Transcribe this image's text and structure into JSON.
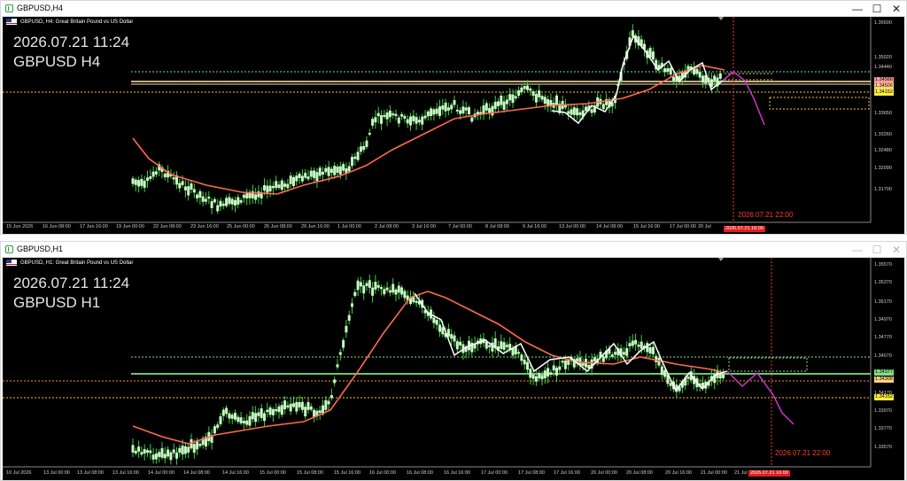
{
  "windows": [
    {
      "title": "GBPUSD,H4",
      "controls": {
        "minimize": "—",
        "maximize": "☐",
        "close": "✕"
      },
      "header": "GBPUSD, H4:  Great Britain Pound vs US Dollar",
      "datetime": "2026.07.21 11:24",
      "symbol_tf": "GBPUSD H4",
      "marker_label": "2026.07.21 22:00",
      "time_box": "2026.07.21 16:00",
      "price_ticks": [
        "1.35600",
        "1.35020",
        "1.34440",
        "1.34230",
        "1.33650",
        "1.33260",
        "1.32480",
        "1.32090",
        "1.31700"
      ],
      "price_boxes": [
        {
          "text": "1.34566",
          "bg": "#ff9aa2"
        },
        {
          "text": "1.34506",
          "bg": "#ffd27f"
        },
        {
          "text": "1.34152",
          "bg": "#ffef3b"
        }
      ],
      "time_ticks": [
        "15 Jun 2026",
        "16 Jun 08:00",
        "17 Jun 16:00",
        "19 Jun 00:00",
        "22 Jun 08:00",
        "23 Jun 16:00",
        "25 Jun 00:00",
        "26 Jun 08:00",
        "29 Jun 16:00",
        "1 Jul 00:00",
        "2 Jul 08:00",
        "3 Jul 16:00",
        "7 Jul 00:00",
        "8 Jul 08:00",
        "9 Jul 16:00",
        "13 Jul 00:00",
        "14 Jul 08:00",
        "15 Jul 16:00",
        "17 Jul 00:00",
        "20 Jul"
      ]
    },
    {
      "title": "GBPUSD,H1",
      "controls": {
        "minimize": "—",
        "maximize": "☐",
        "close": "✕"
      },
      "header": "GBPUSD, H1:  Great Britain Pound vs US Dollar",
      "datetime": "2026.07.21 11:24",
      "symbol_tf": "GBPUSD H1",
      "marker_label": "2026.07.21 22:00",
      "time_box": "2026.07.21 16:00",
      "price_ticks": [
        "1.35570",
        "1.35370",
        "1.35170",
        "1.34970",
        "1.34770",
        "1.34570",
        "1.34370",
        "1.34170",
        "1.33970",
        "1.33770",
        "1.33570"
      ],
      "price_boxes": [
        {
          "text": "1.34377",
          "bg": "#7fe07f"
        },
        {
          "text": "1.34308",
          "bg": "#ffd27f"
        },
        {
          "text": "1.34152",
          "bg": "#ffef3b"
        }
      ],
      "time_ticks": [
        "10 Jul 2026",
        "13 Jul 00:00",
        "13 Jul 08:00",
        "13 Jul 16:00",
        "14 Jul 00:00",
        "14 Jul 08:00",
        "14 Jul 16:00",
        "15 Jul 00:00",
        "15 Jul 08:00",
        "15 Jul 16:00",
        "16 Jul 00:00",
        "16 Jul 08:00",
        "16 Jul 16:00",
        "17 Jul 00:00",
        "17 Jul 08:00",
        "17 Jul 16:00",
        "20 Jul 00:00",
        "20 Jul 08:00",
        "20 Jul 16:00",
        "21 Jul 00:00",
        "21 Jul 08:00"
      ]
    }
  ],
  "colors": {
    "background": "#000000",
    "candle_body": "#c8f7c5",
    "candle_wick": "#3fd13f",
    "moving_average": "#ff6a4d",
    "zigzag": "#ffffff",
    "projection": "#cc33cc",
    "marker_line": "#ff3030",
    "level_dotted": "#f5c242",
    "level_cyan": "#6fd4d4",
    "level_green": "#7fe07f"
  },
  "icons": {
    "window_icon": "chart-window-icon",
    "flag": "gb-flag-icon"
  }
}
